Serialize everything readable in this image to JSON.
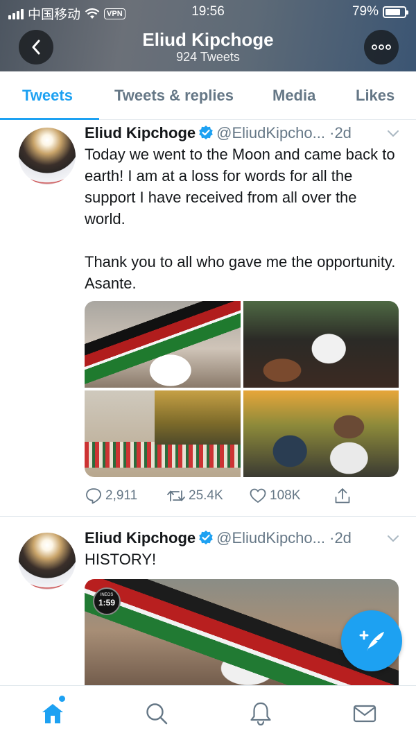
{
  "status_bar": {
    "carrier": "中国移动",
    "vpn": "VPN",
    "time": "19:56",
    "battery": "79%",
    "battery_level": 0.79
  },
  "header": {
    "name": "Eliud Kipchoge",
    "tweet_count": "924 Tweets",
    "gradient_colors": [
      "#4c5560",
      "#3b5573"
    ]
  },
  "tabs": [
    {
      "label": "Tweets",
      "active": true
    },
    {
      "label": "Tweets & replies",
      "active": false
    },
    {
      "label": "Media",
      "active": false
    },
    {
      "label": "Likes",
      "active": false
    }
  ],
  "tweets": [
    {
      "author": "Eliud Kipchoge",
      "handle": "@EliudKipcho...",
      "age": "2d",
      "text": "Today we went to the Moon and came back to earth! I am at a loss for words for all the support I have received from all over the world.\n\nThank you to all who gave me the opportunity. Asante.",
      "media_count": 4,
      "replies": "2,911",
      "retweets": "25.4K",
      "likes": "108K"
    },
    {
      "author": "Eliud Kipchoge",
      "handle": "@EliudKipcho...",
      "age": "2d",
      "text": "HISTORY!",
      "media_badge": "1:59",
      "media_badge_top": "INEOS",
      "media_count": 1
    }
  ],
  "separator": "·",
  "icons": {
    "back": "chevron-left-icon",
    "more": "more-icon",
    "verified": "verified-icon",
    "caret": "chevron-down-icon",
    "reply": "reply-icon",
    "retweet": "retweet-icon",
    "like": "heart-icon",
    "share": "share-icon",
    "compose": "compose-icon",
    "home": "home-icon",
    "search": "search-icon",
    "notifications": "bell-icon",
    "messages": "mail-icon"
  },
  "colors": {
    "accent": "#1da1f2",
    "text": "#14171a",
    "secondary": "#657786",
    "divider": "#e1e8ed"
  }
}
